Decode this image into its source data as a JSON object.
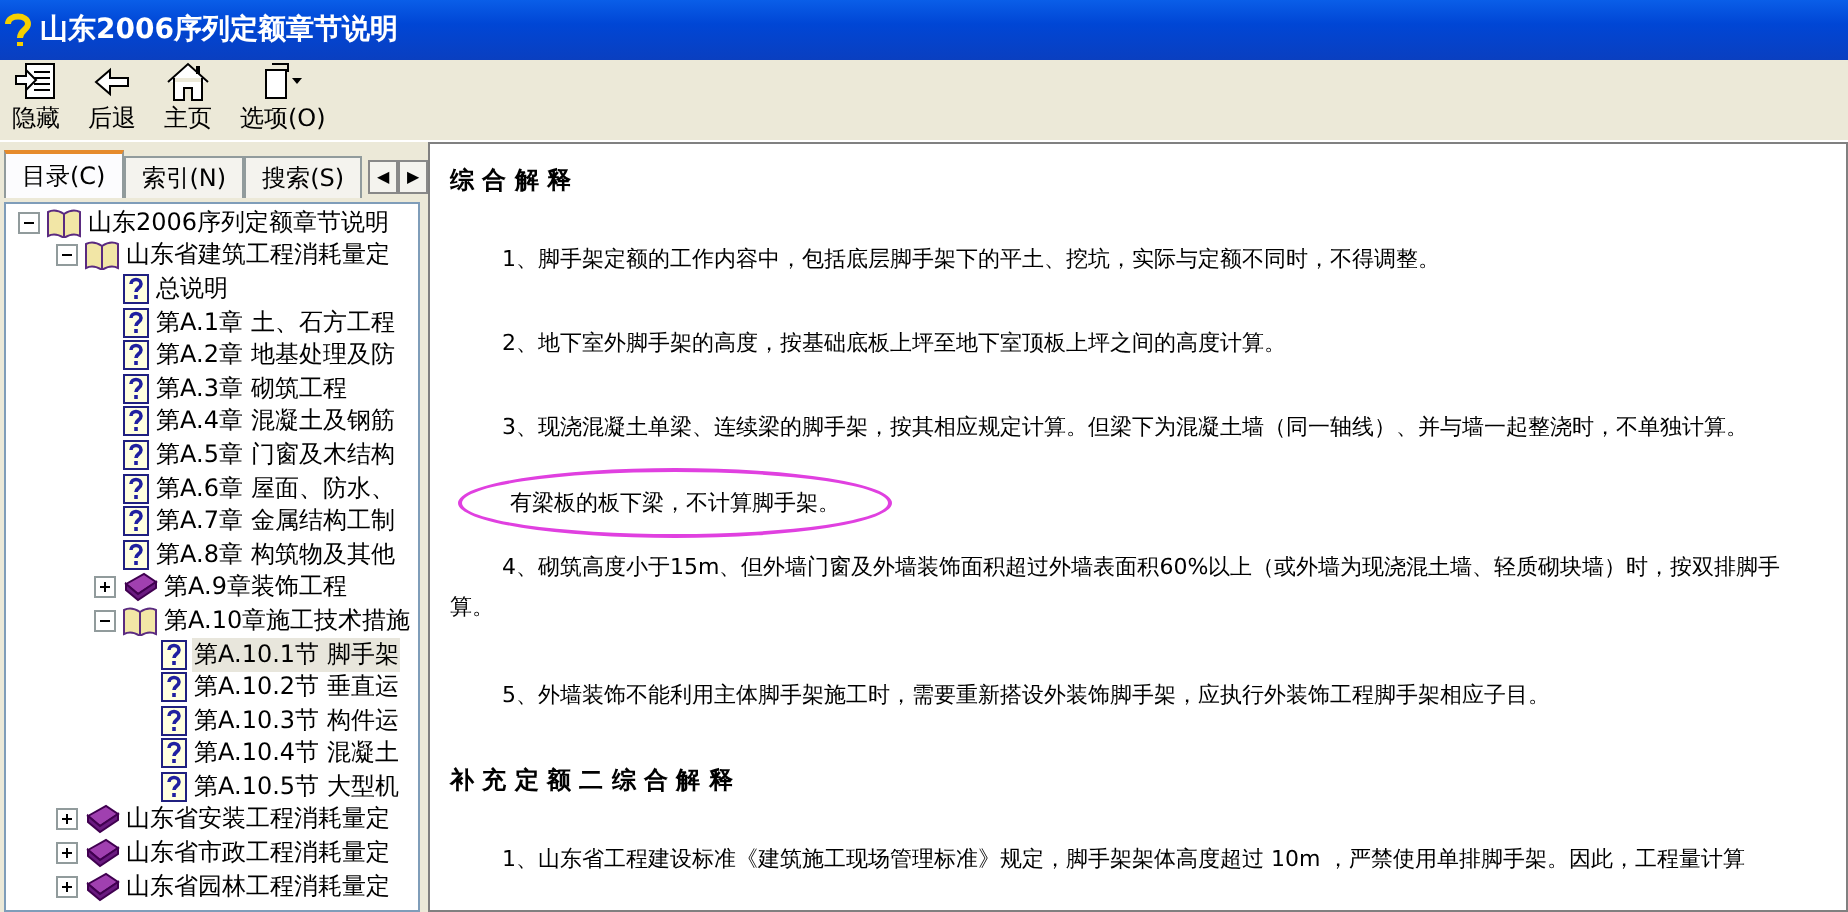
{
  "window": {
    "title": "山东2006序列定额章节说明"
  },
  "toolbar": [
    {
      "label": "隐藏",
      "kind": "hide"
    },
    {
      "label": "后退",
      "kind": "back"
    },
    {
      "label": "主页",
      "kind": "home"
    },
    {
      "label": "选项(O)",
      "kind": "options"
    }
  ],
  "tabs": [
    {
      "label": "目录(C)",
      "selected": true
    },
    {
      "label": "索引(N)",
      "selected": false
    },
    {
      "label": "搜索(S)",
      "selected": false
    }
  ],
  "tab_scroll": [
    "◀",
    "▶"
  ],
  "tree": [
    {
      "label": "山东2006序列定额章节说明",
      "kind": "book",
      "expanded": true,
      "selected": false,
      "children": [
        {
          "label": "山东省建筑工程消耗量定",
          "kind": "book",
          "expanded": true,
          "selected": false,
          "children": [
            {
              "label": "总说明",
              "kind": "page",
              "selected": false
            },
            {
              "label": "第A.1章  土、石方工程",
              "kind": "page",
              "selected": false
            },
            {
              "label": "第A.2章  地基处理及防",
              "kind": "page",
              "selected": false
            },
            {
              "label": "第A.3章  砌筑工程",
              "kind": "page",
              "selected": false
            },
            {
              "label": "第A.4章  混凝土及钢筋",
              "kind": "page",
              "selected": false
            },
            {
              "label": "第A.5章  门窗及木结构",
              "kind": "page",
              "selected": false
            },
            {
              "label": "第A.6章  屋面、防水、",
              "kind": "page",
              "selected": false
            },
            {
              "label": "第A.7章  金属结构工制",
              "kind": "page",
              "selected": false
            },
            {
              "label": "第A.8章  构筑物及其他",
              "kind": "page",
              "selected": false
            },
            {
              "label": "第A.9章装饰工程",
              "kind": "book",
              "expanded": false,
              "selected": false
            },
            {
              "label": "第A.10章施工技术措施",
              "kind": "book",
              "expanded": true,
              "selected": false,
              "children": [
                {
                  "label": "第A.10.1节  脚手架",
                  "kind": "page",
                  "selected": true
                },
                {
                  "label": "第A.10.2节  垂直运",
                  "kind": "page",
                  "selected": false
                },
                {
                  "label": "第A.10.3节  构件运",
                  "kind": "page",
                  "selected": false
                },
                {
                  "label": "第A.10.4节  混凝土",
                  "kind": "page",
                  "selected": false
                },
                {
                  "label": "第A.10.5节  大型机",
                  "kind": "page",
                  "selected": false
                }
              ]
            }
          ]
        },
        {
          "label": "山东省安装工程消耗量定",
          "kind": "book",
          "expanded": false,
          "selected": false
        },
        {
          "label": "山东省市政工程消耗量定",
          "kind": "book",
          "expanded": false,
          "selected": false
        },
        {
          "label": "山东省园林工程消耗量定",
          "kind": "book",
          "expanded": false,
          "selected": false
        }
      ]
    }
  ],
  "content": [
    {
      "kind": "heading",
      "text": "综 合 解 释"
    },
    {
      "kind": "para",
      "text": "1、脚手架定额的工作内容中，包括底层脚手架下的平土、挖坑，实际与定额不同时，不得调整。"
    },
    {
      "kind": "para",
      "text": "2、地下室外脚手架的高度，按基础底板上坪至地下室顶板上坪之间的高度计算。"
    },
    {
      "kind": "para",
      "text": "3、现浇混凝土单梁、连续梁的脚手架，按其相应规定计算。但梁下为混凝土墙（同一轴线）、并与墙一起整浇时，不单独计算。"
    },
    {
      "kind": "circled",
      "text": "有梁板的板下梁，不计算脚手架。"
    },
    {
      "kind": "wrapped",
      "text": "4、砌筑高度小于15m、但外墙门窗及外墙装饰面积超过外墙表面积60%以上（或外墙为现浇混土墙、轻质砌块墙）时，按双排脚手"
    },
    {
      "kind": "cont",
      "text": "算。"
    },
    {
      "kind": "para",
      "text": "5、外墙装饰不能利用主体脚手架施工时，需要重新搭设外装饰脚手架，应执行外装饰工程脚手架相应子目。"
    },
    {
      "kind": "heading",
      "text": "补 充 定 额 二 综 合 解 释"
    },
    {
      "kind": "para",
      "text": "1、山东省工程建设标准《建筑施工现场管理标准》规定，脚手架架体高度超过 10m ，严禁使用单排脚手架。因此，工程量计算"
    }
  ]
}
